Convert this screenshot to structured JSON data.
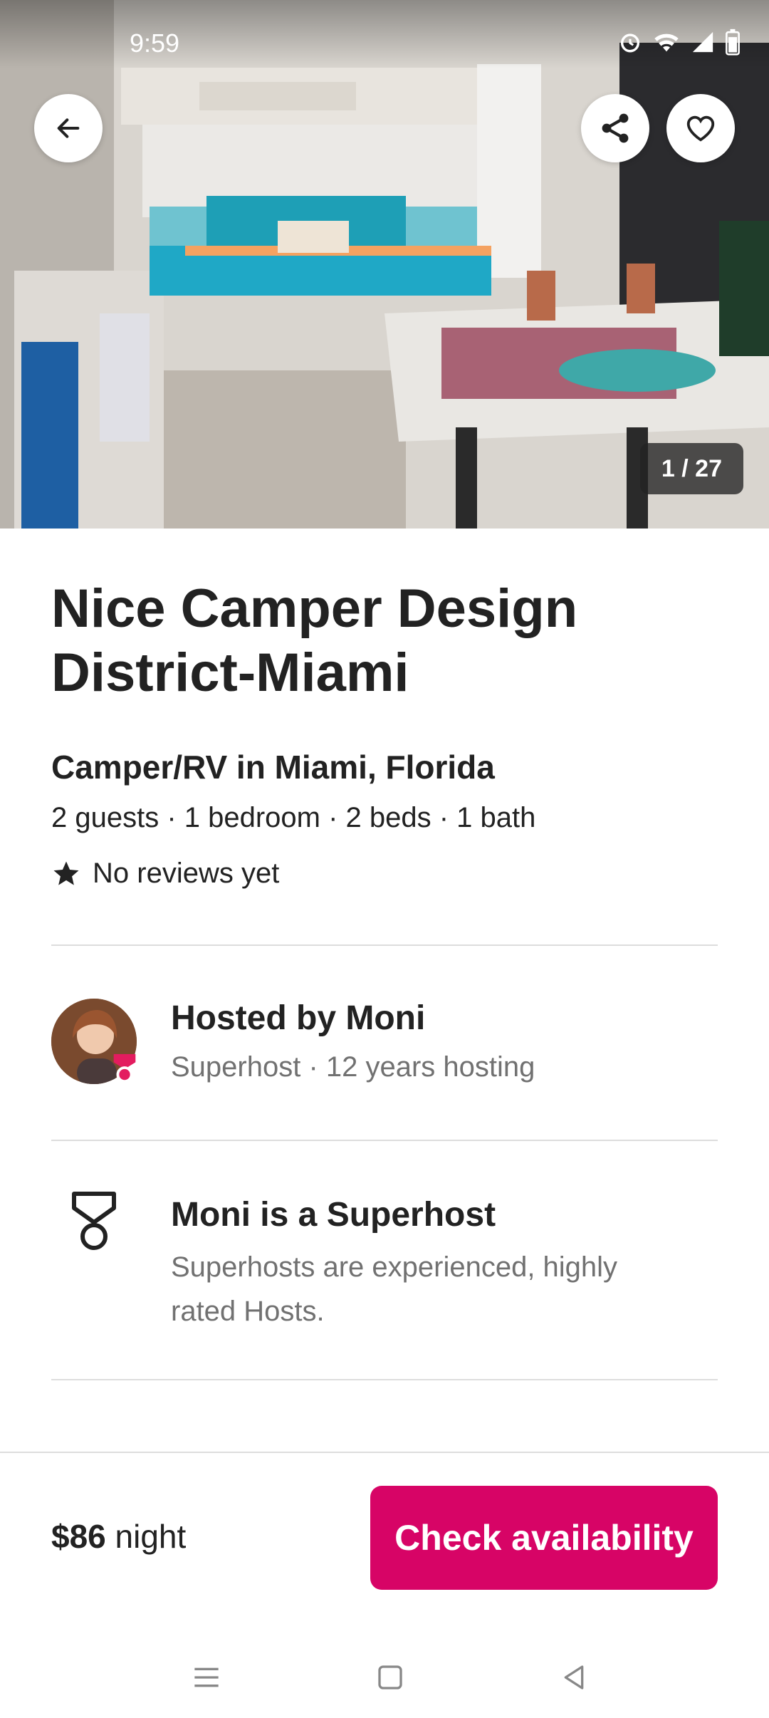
{
  "status_bar": {
    "time": "9:59"
  },
  "gallery": {
    "counter": "1 / 27"
  },
  "listing": {
    "title": "Nice Camper Design District-Miami",
    "subtitle": "Camper/RV in Miami, Florida",
    "details": "2 guests · 1 bedroom · 2 beds · 1 bath",
    "reviews": "No reviews yet"
  },
  "host": {
    "name": "Hosted by Moni",
    "meta": "Superhost · 12 years hosting"
  },
  "superhost": {
    "title": "Moni is a Superhost",
    "description": "Superhosts are experienced, highly rated Hosts."
  },
  "footer": {
    "price": "$86",
    "unit": "night",
    "cta": "Check availability"
  },
  "colors": {
    "brand": "#d70466",
    "text_primary": "#222222",
    "text_secondary": "#717171",
    "divider": "#dddddd"
  },
  "icons": [
    "back-arrow-icon",
    "share-icon",
    "heart-icon",
    "star-icon",
    "superhost-medal-icon",
    "menu-nav-icon",
    "home-nav-icon",
    "back-nav-icon"
  ]
}
